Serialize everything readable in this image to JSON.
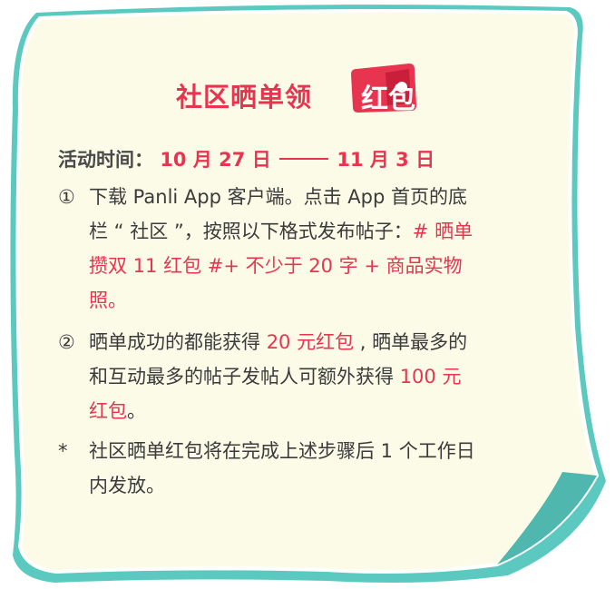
{
  "title": {
    "main": "社区晒单领",
    "badge": "红包"
  },
  "time": {
    "label": "活动时间：",
    "start": "10 月 27 日",
    "end": "11 月 3 日"
  },
  "items": [
    {
      "marker": "①",
      "lines": [
        [
          {
            "t": "下载 Panli App 客户端。点击 App 首页的底"
          }
        ],
        [
          {
            "t": "栏 “ 社区 ”，按照以下格式发布帖子："
          },
          {
            "t": "# 晒单",
            "hl": true
          }
        ],
        [
          {
            "t": "攒双 11 红包 #+ 不少于 20 字 + 商品实物",
            "hl": true
          }
        ],
        [
          {
            "t": "照。",
            "hl": true
          }
        ]
      ]
    },
    {
      "marker": "②",
      "lines": [
        [
          {
            "t": "晒单成功的都能获得 "
          },
          {
            "t": "20 元红包",
            "hl": true
          },
          {
            "t": " , 晒单最多的"
          }
        ],
        [
          {
            "t": "和互动最多的帖子发帖人可额外获得 "
          },
          {
            "t": "100 元",
            "hl": true
          }
        ],
        [
          {
            "t": "红包",
            "hl": true
          },
          {
            "t": "。"
          }
        ]
      ]
    },
    {
      "marker": "*",
      "lines": [
        [
          {
            "t": "社区晒单红包将在完成上述步骤后 1 个工作日"
          }
        ],
        [
          {
            "t": "内发放。"
          }
        ]
      ]
    }
  ],
  "colors": {
    "paper": "#fbfbe8",
    "border": "#5cc9c0",
    "accent": "#e8354f",
    "text": "#3b3b3b"
  }
}
